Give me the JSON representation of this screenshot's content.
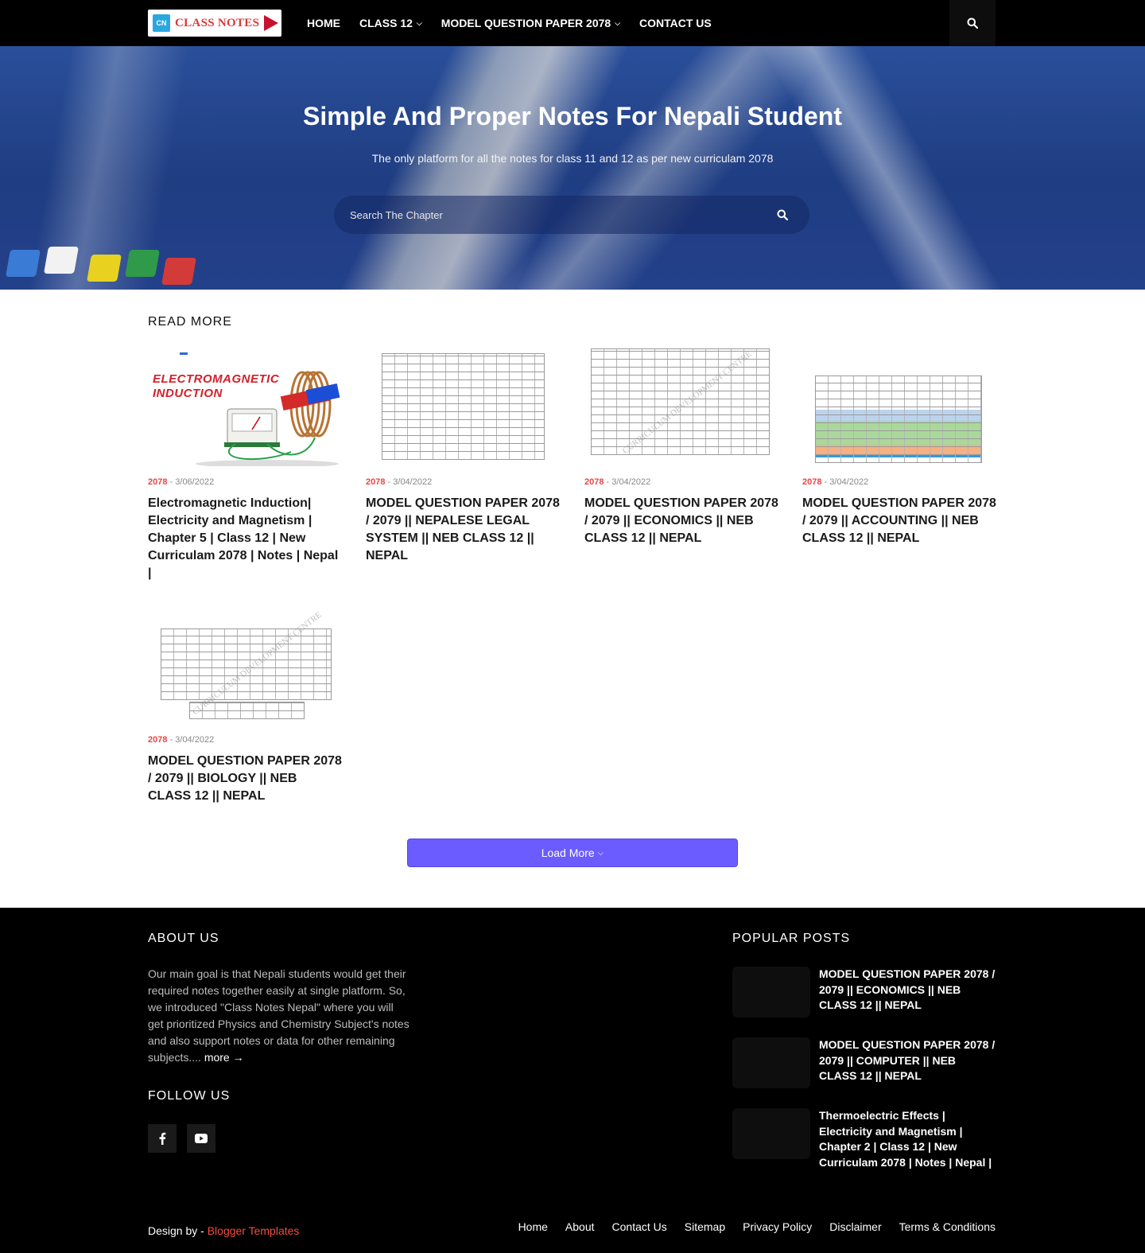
{
  "nav": {
    "logo_mark": "CN",
    "logo_text": "CLASS NOTES",
    "items": [
      {
        "label": "HOME",
        "dropdown": false
      },
      {
        "label": "CLASS 12",
        "dropdown": true
      },
      {
        "label": "MODEL QUESTION PAPER 2078",
        "dropdown": true
      },
      {
        "label": "CONTACT US",
        "dropdown": false
      }
    ],
    "search_icon": "search-icon"
  },
  "hero": {
    "title": "Simple And Proper Notes For Nepali Student",
    "subtitle": "The only platform for all the notes for class 11 and 12 as per new curriculam 2078",
    "search_placeholder": "Search The Chapter"
  },
  "posts_section": {
    "heading": "READ MORE",
    "posts": [
      {
        "year": "2078",
        "date": "3/06/2022",
        "title": "Electromagnetic Induction| Electricity and Magnetism | Chapter 5 | Class 12 | New Curriculam 2078 | Notes | Nepal |",
        "thumb_text_1": "ELECTROMAGNETIC",
        "thumb_text_2": "INDUCTION"
      },
      {
        "year": "2078",
        "date": "3/04/2022",
        "title": "MODEL QUESTION PAPER 2078 / 2079 || NEPALESE LEGAL SYSTEM || NEB CLASS 12 || NEPAL"
      },
      {
        "year": "2078",
        "date": "3/04/2022",
        "title": "MODEL QUESTION PAPER 2078 / 2079 || ECONOMICS || NEB CLASS 12 || NEPAL",
        "thumb_watermark": "CURRICULUM DEVELOPMENT CENTRE"
      },
      {
        "year": "2078",
        "date": "3/04/2022",
        "title": "MODEL QUESTION PAPER 2078 / 2079 || ACCOUNTING || NEB CLASS 12 || NEPAL"
      },
      {
        "year": "2078",
        "date": "3/04/2022",
        "title": "MODEL QUESTION PAPER 2078 / 2079 || BIOLOGY || NEB CLASS 12 || NEPAL",
        "thumb_watermark": "CURRICULUM DEVELOPMENT CENTRE"
      }
    ],
    "load_more": "Load More"
  },
  "footer": {
    "about_heading": "ABOUT US",
    "about_text": "Our main goal is that Nepali students would get their required notes together easily at single platform. So, we introduced \"Class Notes Nepal\" where you will get prioritized Physics and Chemistry Subject's notes and also support notes or data for other remaining subjects....",
    "about_more": "more →",
    "follow_heading": "FOLLOW US",
    "social": [
      "facebook-icon",
      "youtube-icon"
    ],
    "popular_heading": "POPULAR POSTS",
    "popular": [
      {
        "title": "MODEL QUESTION PAPER 2078 / 2079 || ECONOMICS || NEB CLASS 12 || NEPAL"
      },
      {
        "title": "MODEL QUESTION PAPER 2078 / 2079 || COMPUTER || NEB CLASS 12 || NEPAL"
      },
      {
        "title": "Thermoelectric Effects | Electricity and Magnetism | Chapter 2 | Class 12 | New Curriculam 2078 | Notes | Nepal |"
      }
    ],
    "design_prefix": "Design by - ",
    "design_link": "Blogger Templates",
    "links": [
      "Home",
      "About",
      "Contact Us",
      "Sitemap",
      "Privacy Policy",
      "Disclaimer",
      "Terms & Conditions"
    ]
  },
  "colors": {
    "accent": "#6a5cff",
    "date_year": "#e84545",
    "design_link": "#f04e3e",
    "navbar": "#000000",
    "footer": "#000000"
  }
}
